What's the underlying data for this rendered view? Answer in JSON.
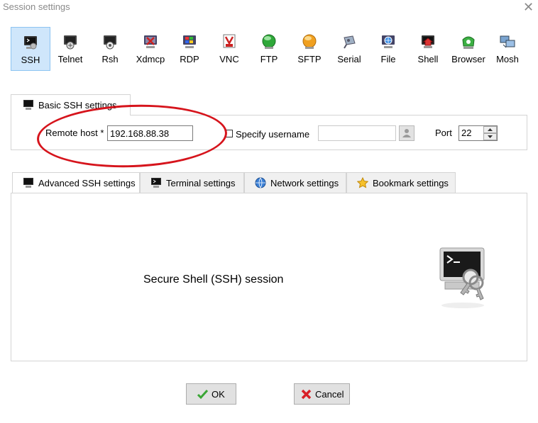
{
  "window": {
    "title": "Session settings",
    "close_glyph": "✕"
  },
  "protocols": [
    {
      "label": "SSH",
      "icon": "ssh-terminal-icon",
      "selected": true
    },
    {
      "label": "Telnet",
      "icon": "telnet-icon"
    },
    {
      "label": "Rsh",
      "icon": "rsh-icon"
    },
    {
      "label": "Xdmcp",
      "icon": "xdmcp-icon"
    },
    {
      "label": "RDP",
      "icon": "rdp-icon"
    },
    {
      "label": "VNC",
      "icon": "vnc-icon"
    },
    {
      "label": "FTP",
      "icon": "ftp-icon"
    },
    {
      "label": "SFTP",
      "icon": "sftp-icon"
    },
    {
      "label": "Serial",
      "icon": "serial-icon"
    },
    {
      "label": "File",
      "icon": "file-icon"
    },
    {
      "label": "Shell",
      "icon": "shell-icon"
    },
    {
      "label": "Browser",
      "icon": "browser-icon"
    },
    {
      "label": "Mosh",
      "icon": "mosh-icon"
    }
  ],
  "basic": {
    "tab_label": "Basic SSH settings",
    "remote_host_label": "Remote host *",
    "remote_host_value": "192.168.88.38",
    "specify_username_label": "Specify username",
    "specify_username_checked": false,
    "username_value": "",
    "port_label": "Port",
    "port_value": "22"
  },
  "tabs": [
    {
      "label": "Advanced SSH settings",
      "icon": "terminal-icon"
    },
    {
      "label": "Terminal settings",
      "icon": "terminal-settings-icon"
    },
    {
      "label": "Network settings",
      "icon": "globe-icon"
    },
    {
      "label": "Bookmark settings",
      "icon": "star-icon"
    }
  ],
  "main": {
    "description": "Secure Shell (SSH) session"
  },
  "buttons": {
    "ok_label": "OK",
    "cancel_label": "Cancel"
  },
  "colors": {
    "selected_bg": "#cfe6fb",
    "annotation": "#d6141c",
    "ok_check": "#3aa635",
    "cancel_x": "#d82027"
  }
}
